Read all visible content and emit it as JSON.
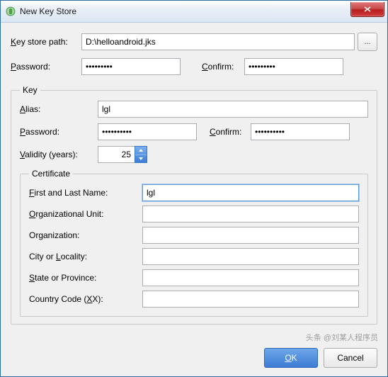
{
  "window": {
    "title": "New Key Store",
    "close_tooltip": "Close"
  },
  "keystore": {
    "path_label_pre": "K",
    "path_label_rest": "ey store path:",
    "path_value": "D:\\helloandroid.jks",
    "browse_label": "...",
    "password_label_pre": "P",
    "password_label_rest": "assword:",
    "password_value": "•••••••••",
    "confirm_label_pre": "C",
    "confirm_label_rest": "onfirm:",
    "confirm_value": "•••••••••"
  },
  "key": {
    "legend": "Key",
    "alias_label_pre": "A",
    "alias_label_rest": "lias:",
    "alias_value": "lgl",
    "password_label_pre": "P",
    "password_label_rest": "assword:",
    "password_value": "••••••••••",
    "confirm_label_pre": "C",
    "confirm_label_rest": "onfirm:",
    "confirm_value": "••••••••••",
    "validity_label_pre": "V",
    "validity_label_rest": "alidity (years):",
    "validity_value": "25"
  },
  "cert": {
    "legend": "Certificate",
    "first_last_pre": "F",
    "first_last_rest": "irst and Last Name:",
    "first_last_value": "lgl",
    "org_unit_pre": "O",
    "org_unit_rest": "rganizational Unit:",
    "org_unit_value": "",
    "org_label": "Organization:",
    "org_value": "",
    "city_pre": "L",
    "city_preText": "City or ",
    "city_rest": "ocality:",
    "city_value": "",
    "state_pre": "S",
    "state_rest": "tate or Province:",
    "state_value": "",
    "country_preText": "Country Code (",
    "country_u": "X",
    "country_rest": "X):",
    "country_value": ""
  },
  "buttons": {
    "ok_pre": "O",
    "ok_rest": "K",
    "cancel": "Cancel"
  },
  "watermark": "头条 @刘某人程序员"
}
